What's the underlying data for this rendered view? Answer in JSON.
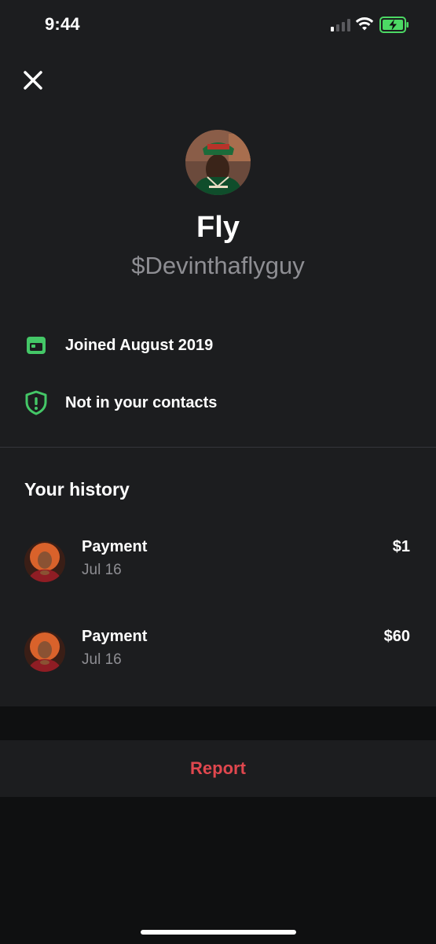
{
  "status_bar": {
    "time": "9:44",
    "signal_icon": "cell-signal-icon",
    "wifi_icon": "wifi-icon",
    "battery_icon": "battery-charging-icon",
    "battery_color": "#4cd964"
  },
  "header": {
    "close_icon": "close-icon"
  },
  "profile": {
    "display_name": "Fly",
    "cashtag": "$Devinthaflyguy"
  },
  "info": [
    {
      "icon": "calendar-icon",
      "label": "Joined August 2019"
    },
    {
      "icon": "shield-alert-icon",
      "label": "Not in your contacts"
    }
  ],
  "history": {
    "title": "Your history",
    "items": [
      {
        "title": "Payment",
        "date": "Jul 16",
        "amount": "$1"
      },
      {
        "title": "Payment",
        "date": "Jul 16",
        "amount": "$60"
      }
    ]
  },
  "report": {
    "label": "Report",
    "color": "#e0474e"
  },
  "colors": {
    "accent_green": "#44c767",
    "background": "#1c1d1f",
    "secondary_text": "#8e8e93"
  }
}
